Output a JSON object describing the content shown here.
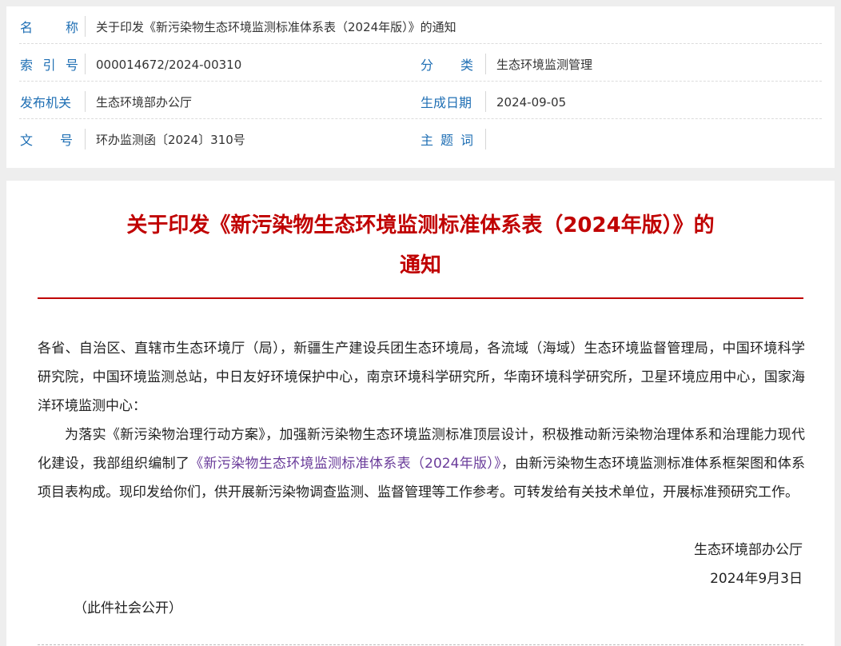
{
  "meta": {
    "name_label": "名称",
    "name_value": "关于印发《新污染物生态环境监测标准体系表（2024年版）》的通知",
    "index_label": "索引号",
    "index_value": "000014672/2024-00310",
    "category_label": "分类",
    "category_value": "生态环境监测管理",
    "issuer_label": "发布机关",
    "issuer_value": "生态环境部办公厅",
    "date_label": "生成日期",
    "date_value": "2024-09-05",
    "docno_label": "文号",
    "docno_value": "环办监测函〔2024〕310号",
    "topic_label": "主题词",
    "topic_value": ""
  },
  "document": {
    "title_line1": "关于印发《新污染物生态环境监测标准体系表（2024年版）》的",
    "title_line2": "通知",
    "recipients": "各省、自治区、直辖市生态环境厅（局），新疆生产建设兵团生态环境局，各流域（海域）生态环境监督管理局，中国环境科学研究院，中国环境监测总站，中日友好环境保护中心，南京环境科学研究所，华南环境科学研究所，卫星环境应用中心，国家海洋环境监测中心：",
    "body_part1": "为落实《新污染物治理行动方案》，加强新污染物生态环境监测标准顶层设计，积极推动新污染物治理体系和治理能力现代化建设，我部组织编制了",
    "body_link": "《新污染物生态环境监测标准体系表（2024年版）》",
    "body_part2": "，由新污染物生态环境监测标准体系框架图和体系项目表构成。现印发给你们，供开展新污染物调查监测、监督管理等工作参考。可转发给有关技术单位，开展标准预研究工作。",
    "signature": "生态环境部办公厅",
    "sign_date": "2024年9月3日",
    "public_note": "（此件社会公开）"
  },
  "colors": {
    "label_blue": "#1f6fb4",
    "title_red": "#c00000",
    "link_purple": "#6a3c9a"
  }
}
